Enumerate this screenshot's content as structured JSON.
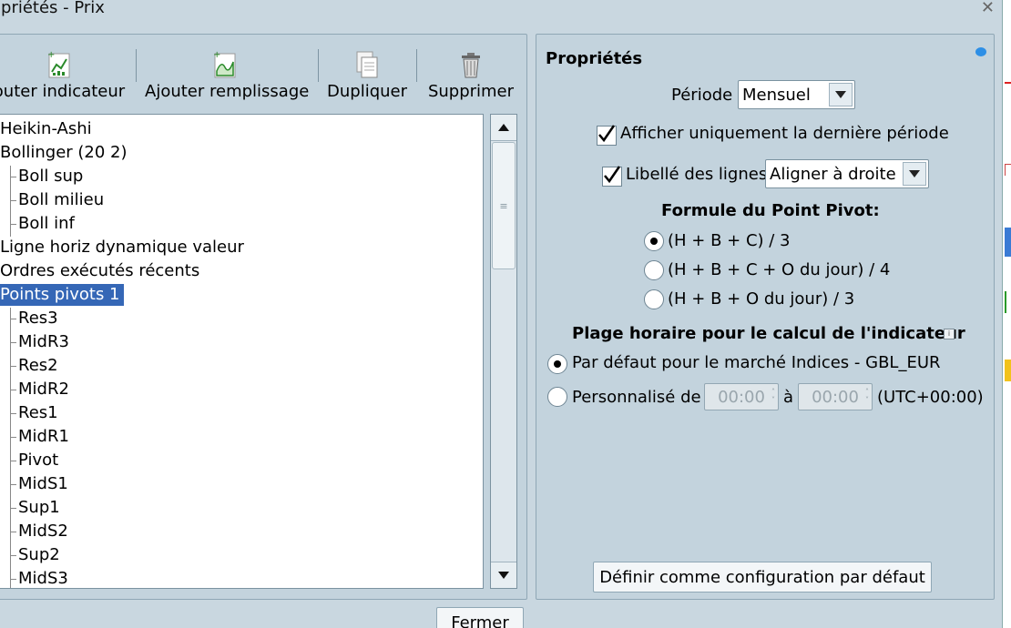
{
  "window": {
    "title": "opriétés - Prix"
  },
  "toolbar": {
    "add_indicator": "outer indicateur",
    "add_fill": "Ajouter remplissage",
    "duplicate": "Dupliquer",
    "delete": "Supprimer"
  },
  "tree": {
    "items": [
      {
        "label": "Heikin-Ashi",
        "level": 0
      },
      {
        "label": "Bollinger (20 2)",
        "level": 0
      },
      {
        "label": "Boll sup",
        "level": 1
      },
      {
        "label": "Boll milieu",
        "level": 1
      },
      {
        "label": "Boll inf",
        "level": 1
      },
      {
        "label": "Ligne horiz dynamique valeur",
        "level": 0
      },
      {
        "label": "Ordres exécutés récents",
        "level": 0
      },
      {
        "label": "Points pivots 1",
        "level": 0,
        "selected": true
      },
      {
        "label": "Res3",
        "level": 1
      },
      {
        "label": "MidR3",
        "level": 1
      },
      {
        "label": "Res2",
        "level": 1
      },
      {
        "label": "MidR2",
        "level": 1
      },
      {
        "label": "Res1",
        "level": 1
      },
      {
        "label": "MidR1",
        "level": 1
      },
      {
        "label": "Pivot",
        "level": 1
      },
      {
        "label": "MidS1",
        "level": 1
      },
      {
        "label": "Sup1",
        "level": 1
      },
      {
        "label": "MidS2",
        "level": 1
      },
      {
        "label": "Sup2",
        "level": 1
      },
      {
        "label": "MidS3",
        "level": 1
      }
    ]
  },
  "properties": {
    "heading": "Propriétés",
    "period_label": "Période",
    "period_value": "Mensuel",
    "last_period_only": {
      "label": "Afficher uniquement la dernière période",
      "checked": true
    },
    "line_labels": {
      "label": "Libellé des lignes",
      "checked": true,
      "value": "Aligner à droite"
    },
    "pivot_formula_heading": "Formule du Point Pivot:",
    "formula_options": [
      {
        "label": "(H + B + C) / 3",
        "selected": true
      },
      {
        "label": "(H + B + C + O du jour) / 4",
        "selected": false
      },
      {
        "label": "(H + B + O du jour) / 3",
        "selected": false
      }
    ],
    "time_range_heading": "Plage horaire pour le calcul de l'indicateur",
    "default_market_option": "Par défaut pour le marché Indices - GBL_EUR",
    "custom_option_label": "Personnalisé de",
    "custom_to": "à",
    "custom_from_time": "00:00",
    "custom_to_time": "00:00",
    "timezone": "(UTC+00:00)",
    "set_default_button": "Définir comme configuration par défaut"
  },
  "footer": {
    "close_button": "Fermer"
  }
}
